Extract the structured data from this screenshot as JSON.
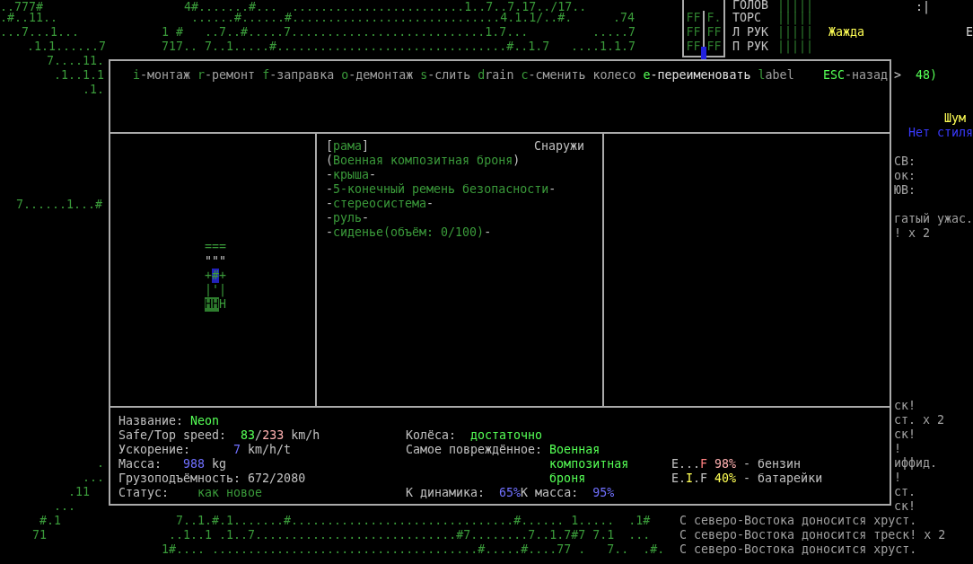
{
  "map": {
    "segments": [
      "..777#",
      "4#.......#...  ........................1..7..7.17../17..",
      ".#..11..",
      "......#......#.............................4.1.1/..#.",
      ".74",
      "...7...1...",
      "1 #",
      "..7..#.....7...........................1.7...",
      ".....7",
      ".1.1......7",
      "717.. 7..1.....#................................#..1.7",
      "....1.1.7",
      "7....11.",
      ".1..1.1",
      ".1.",
      "7......1...#",
      ".",
      "...",
      ".11",
      "...",
      "#.1",
      "7..1.#.1.......#...............................#...... 1.....  .1#",
      "71",
      "..1..1 .1..7............................#7........7..1.7#7 7.1  ...",
      "1#.... .....................................#.....#....77 .   7..  .#."
    ]
  },
  "limbs": {
    "rows": [
      [
        "FF",
        "F."
      ],
      [
        "FF",
        "FF"
      ],
      [
        "FF",
        "FF"
      ]
    ]
  },
  "body_parts": [
    {
      "name": "ГОЛОВ",
      "bar": "|||||"
    },
    {
      "name": "ТОРС",
      "bar": "|||||"
    },
    {
      "name": "Л РУК",
      "bar": "|||||"
    },
    {
      "name": "П РУК",
      "bar": "|||||"
    }
  ],
  "side_texts": [
    {
      "text": ":|",
      "kind": "plain"
    },
    {
      "text": "Жажда",
      "kind": "warning"
    },
    {
      "text": "E",
      "kind": "plain"
    },
    {
      "text": ">",
      "kind": "plain"
    },
    {
      "text": "48)",
      "kind": "value"
    },
    {
      "text": "Шум",
      "kind": "warning"
    },
    {
      "text": "Нет стиля",
      "kind": "style"
    },
    {
      "text": "СВ:",
      "kind": "log"
    },
    {
      "text": "ок:",
      "kind": "log"
    },
    {
      "text": "ЮВ:",
      "kind": "log"
    },
    {
      "text": "гатый ужас.",
      "kind": "log"
    },
    {
      "text": "! x 2",
      "kind": "log"
    },
    {
      "text": "ск!",
      "kind": "log"
    },
    {
      "text": "ст. x 2",
      "kind": "log"
    },
    {
      "text": "ск!",
      "kind": "log"
    },
    {
      "text": "!",
      "kind": "log"
    },
    {
      "text": "иффид.",
      "kind": "log"
    },
    {
      "text": "!",
      "kind": "log"
    },
    {
      "text": "ст.",
      "kind": "log"
    },
    {
      "text": "ск!",
      "kind": "log"
    }
  ],
  "log": [
    "С северо-Востока доносится хруст.",
    "С северо-Востока доносится треск! x 2",
    "С северо-Востока доносится хруст."
  ],
  "dialog": {
    "actions": [
      {
        "key": "i",
        "label": "-монтаж",
        "enabled": false
      },
      {
        "key": "r",
        "label": "-ремонт",
        "enabled": false
      },
      {
        "key": "f",
        "label": "-заправка",
        "enabled": false
      },
      {
        "key": "o",
        "label": "-демонтаж",
        "enabled": false
      },
      {
        "key": "s",
        "label": "-слить",
        "enabled": false
      },
      {
        "key": "d",
        "label": "rain",
        "enabled": false
      },
      {
        "key": "c",
        "label": "-сменить колесо",
        "enabled": false
      },
      {
        "key": "e",
        "label": "-переименовать",
        "enabled": true
      },
      {
        "key": "l",
        "label": "abel",
        "enabled": false
      }
    ],
    "back": {
      "key": "ESC",
      "label": "-назад"
    },
    "vehicle": {
      "rows": [
        {
          "kind": "frame",
          "cells": [
            {
              "ch": "=",
              "selected": false,
              "installed": false
            },
            {
              "ch": "=",
              "selected": false,
              "installed": false
            },
            {
              "ch": "=",
              "selected": false,
              "installed": false
            }
          ]
        },
        {
          "kind": "seat",
          "cells": [
            {
              "ch": "\"",
              "selected": false,
              "installed": false
            },
            {
              "ch": "\"",
              "selected": false,
              "installed": false
            },
            {
              "ch": "\"",
              "selected": false,
              "installed": false
            }
          ]
        },
        {
          "kind": "frame",
          "cells": [
            {
              "ch": "+",
              "selected": false,
              "installed": false
            },
            {
              "ch": "#",
              "selected": true,
              "installed": false
            },
            {
              "ch": "+",
              "selected": false,
              "installed": false
            }
          ]
        },
        {
          "kind": "frame",
          "cells": [
            {
              "ch": "|",
              "selected": false,
              "installed": false
            },
            {
              "ch": "'",
              "selected": false,
              "installed": false
            },
            {
              "ch": "|",
              "selected": false,
              "installed": false
            }
          ]
        },
        {
          "kind": "frame",
          "cells": [
            {
              "ch": "H",
              "selected": false,
              "installed": true
            },
            {
              "ch": "H",
              "selected": false,
              "installed": true
            },
            {
              "ch": "H",
              "selected": false,
              "installed": false
            }
          ]
        }
      ]
    },
    "tile": {
      "open": "[",
      "name": "рама",
      "close": "]",
      "location": "Снаружи"
    },
    "parts": [
      {
        "open": "(",
        "name": "Военная композитная броня",
        "close": ")"
      },
      {
        "open": "-",
        "name": "крыша",
        "close": "-"
      },
      {
        "open": "-",
        "name": "5-конечный ремень безопасности",
        "close": "-"
      },
      {
        "open": "-",
        "name": "стереосистема",
        "close": "-"
      },
      {
        "open": "-",
        "name": "руль",
        "close": "-"
      },
      {
        "open": "-",
        "name": "сиденье(объём: 0/100)",
        "close": "-"
      }
    ],
    "stats": [
      {
        "label": "Название:",
        "parts": [
          {
            "text": "Neon",
            "color": "#55ff55"
          }
        ]
      },
      {
        "label": "Safe/Top speed:",
        "parts": [
          {
            "text": "83",
            "color": "#55ff55"
          },
          {
            "text": "/",
            "color": "#c0c0c0"
          },
          {
            "text": "233",
            "color": "#ffb0b0"
          },
          {
            "text": " km/h",
            "color": "#c0c0c0"
          }
        ]
      },
      {
        "label": "Ускорение:",
        "parts": [
          {
            "text": "7",
            "color": "#7070ff"
          },
          {
            "text": " km/h/t",
            "color": "#c0c0c0"
          }
        ]
      },
      {
        "label": "Масса:",
        "parts": [
          {
            "text": "988",
            "color": "#7070ff"
          },
          {
            "text": " kg",
            "color": "#c0c0c0"
          }
        ]
      },
      {
        "label": "Грузоподъёмность:",
        "parts": [
          {
            "text": "672/2080",
            "color": "#c0c0c0"
          }
        ]
      },
      {
        "label": "Статус:",
        "parts": [
          {
            "text": "как новое",
            "color": "#3a9a3a"
          }
        ]
      }
    ],
    "wheels": {
      "label": "Колёса:",
      "value": "достаточно"
    },
    "most_damaged": {
      "label": "Самое повреждённое:",
      "value": "Военная композитная броня"
    },
    "dynamics": {
      "label": "К динамика:",
      "value": "65%",
      "mass_label": "К масса:",
      "mass_value": "95%"
    },
    "fuels": [
      {
        "gauge": [
          {
            "text": "E...",
            "color": "#c0c0c0"
          },
          {
            "text": "F",
            "color": "#ff8080"
          }
        ],
        "percent": "98%",
        "color": "#ffb0b0",
        "label": "- бензин"
      },
      {
        "gauge": [
          {
            "text": "E.",
            "color": "#c0c0c0"
          },
          {
            "text": "I",
            "color": "#ffff55"
          },
          {
            "text": ".F",
            "color": "#c0c0c0"
          }
        ],
        "percent": "40%",
        "color": "#ffff55",
        "label": "- батарейки"
      }
    ]
  }
}
